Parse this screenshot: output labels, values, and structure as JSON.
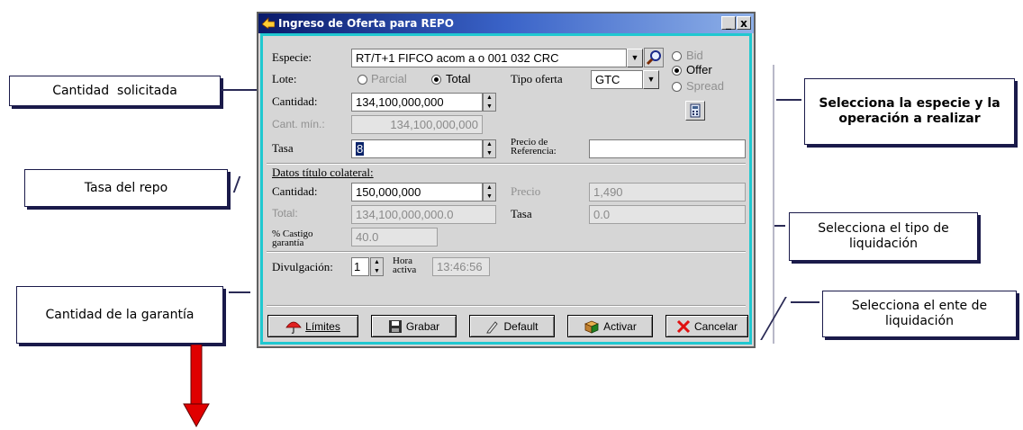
{
  "window": {
    "title": "Ingreso de Oferta para REPO",
    "minimize": "_",
    "close": "x"
  },
  "form": {
    "especie_label": "Especie:",
    "especie_value": "RT/T+1 FIFCO acom a o 001 032 CRC",
    "lote_label": "Lote:",
    "lote_parcial": "Parcial",
    "lote_total": "Total",
    "tipo_oferta_label": "Tipo oferta",
    "tipo_oferta_value": "GTC",
    "side_bid": "Bid",
    "side_offer": "Offer",
    "side_spread": "Spread",
    "cantidad_label": "Cantidad:",
    "cantidad_value": "134,100,000,000",
    "cant_min_label": "Cant. mín.:",
    "cant_min_value": "134,100,000,000",
    "tasa_label": "Tasa",
    "tasa_value": "8",
    "precio_ref_label_1": "Precio de",
    "precio_ref_label_2": "Referencia:",
    "precio_ref_value": ""
  },
  "colateral": {
    "section_label": "Datos título colateral:",
    "cantidad_label": "Cantidad:",
    "cantidad_value": "150,000,000",
    "precio_label": "Precio",
    "precio_value": "1,490",
    "total_label": "Total:",
    "total_value": "134,100,000,000.0",
    "tasa_label": "Tasa",
    "tasa_value": "0.0",
    "castigo_label_1": "% Castigo",
    "castigo_label_2": "garantía",
    "castigo_value": "40.0"
  },
  "footer": {
    "divulgacion_label": "Divulgación:",
    "divulgacion_value": "1",
    "hora_label_1": "Hora",
    "hora_label_2": "activa",
    "hora_value": "13:46:56"
  },
  "buttons": {
    "limites": "Límites",
    "grabar": "Grabar",
    "default": "Default",
    "activar": "Activar",
    "cancelar": "Cancelar"
  },
  "callouts": {
    "cantidad_solicitada": "Cantidad  solicitada",
    "tasa_repo": "Tasa del repo",
    "cantidad_garantia": "Cantidad de la garantía",
    "selecciona_especie": "Selecciona la especie y la operación a realizar",
    "selecciona_tipo": "Selecciona el tipo de liquidación",
    "selecciona_ente": "Selecciona el ente de liquidación"
  },
  "colors": {
    "title_start": "#0a1a6a",
    "title_end": "#8eb0e8",
    "frame_accent": "#20c8d0",
    "arrow": "#e00000"
  }
}
